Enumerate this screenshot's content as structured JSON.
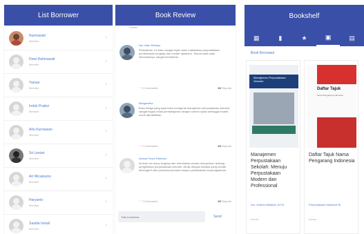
{
  "panels": {
    "list_borrower": {
      "title": "List Borrower",
      "borrowers": [
        {
          "name": "Nurmawati",
          "sub": "Member"
        },
        {
          "name": "Dewi Rahmawati",
          "sub": "Member"
        },
        {
          "name": "Yanuar",
          "sub": "Member"
        },
        {
          "name": "Indah Pratiwi",
          "sub": "Member"
        },
        {
          "name": "Arie Kurniawan",
          "sub": "Member"
        },
        {
          "name": "Sri Lestari",
          "sub": "Member"
        },
        {
          "name": "Ari Wicaksono",
          "sub": "Member"
        },
        {
          "name": "Haryanto",
          "sub": "Member"
        },
        {
          "name": "Saadia Ismail",
          "sub": "Member"
        }
      ]
    },
    "book_review": {
      "title": "Book Review",
      "top_sliver": "Ulasan",
      "reviews": [
        {
          "name": "Nur Intan Rahayu",
          "text": "Pelestarian, Ini buku sangat tepat untuk mahasiswa perpustakaan, pembahasan lengkap dan mudah dipahami. Terima kasih atas informasinya, sangat membantu.",
          "comments": "2 Comments",
          "likes": "26",
          "action": "Reports"
        },
        {
          "name": "Margaretha",
          "text": "Buku ketiga yang saya baca mengenai manajemen perpustakaan sekolah, sangat bagus untuk pembelajaran dengan contoh nyata sehingga mudah untuk dipraktikkan.",
          "comments": "2 Comments",
          "likes": "26",
          "action": "Reports"
        },
        {
          "name": "Ahmad Yusuf Rahman",
          "text": "Isi buku ini cukup lengkap dan membahas secara menyeluruh tentang pengelolaan perpustakaan sekolah, ditulis dengan bahasa yang mudah dimengerti oleh pembaca pemula maupun pustakawan berpengalaman.",
          "comments": "2 Comments",
          "likes": "26",
          "action": "Reports"
        }
      ],
      "comment_placeholder": "Tulis komentar...",
      "send_label": "Send"
    },
    "bookshelf": {
      "title": "Bookshelf",
      "tabs": [
        "▦",
        "▮",
        "★",
        "▣",
        "▤"
      ],
      "section": "Book Borrowed",
      "books": [
        {
          "cover_title": "Manajemen Perpustakaan Sekolah",
          "title": "Manajemen Perpustakaan Sekolah: Menuju Perpustakaan Modern dan Professional",
          "author": "Drs. Ibrahim Bafadal, M.Pd.",
          "meta": "Penerbit"
        },
        {
          "cover_title": "Daftar Tajuk",
          "cover_sub": "Nama Pengarang Indonesia",
          "title": "Daftar Tajuk Nama Pengarang Indonesia",
          "author": "Perpustakaan Nasional RI",
          "meta": "Penerbit"
        }
      ]
    }
  }
}
